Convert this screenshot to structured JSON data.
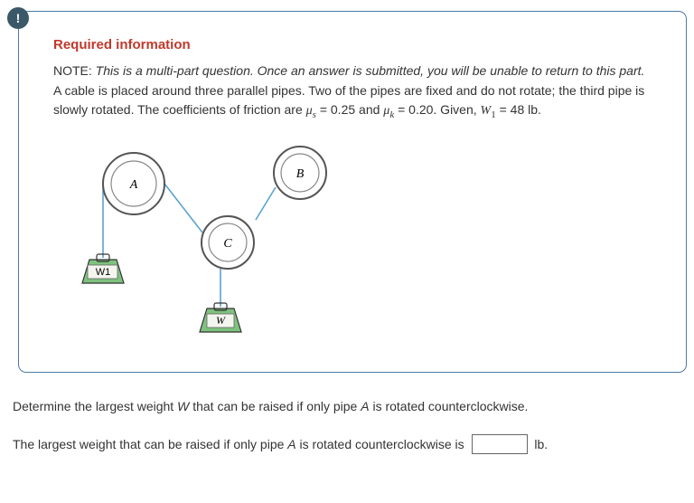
{
  "badge": "!",
  "header": {
    "title": "Required information"
  },
  "note": {
    "label": "NOTE:",
    "body": "This is a multi-part question. Once an answer is submitted, you will be unable to return to this part."
  },
  "desc": {
    "line1": "A cable is placed around three parallel pipes. Two of the pipes are fixed and do not rotate; the third pipe is slowly rotated. The coefficients of friction are ",
    "mu_s_sym": "μ",
    "mu_s_sub": "s",
    "mu_s_val": " = 0.25 and ",
    "mu_k_sym": "μ",
    "mu_k_sub": "k",
    "line2_rest": " = 0.20. Given, ",
    "w_sym": "W",
    "w_sub": "1",
    "w_val": " = 48 lb."
  },
  "diagram": {
    "labelA": "A",
    "labelB": "B",
    "labelC": "C",
    "labelW1": "W1",
    "labelW": "W"
  },
  "question": {
    "pre": "Determine the largest weight ",
    "var1": "W",
    "mid": " that can be raised if only pipe ",
    "var2": "A",
    "post": " is rotated counterclockwise."
  },
  "answer": {
    "pre": "The largest weight that can be raised if only pipe ",
    "var1": "A",
    "mid": " is rotated counterclockwise is ",
    "unit": " lb."
  }
}
